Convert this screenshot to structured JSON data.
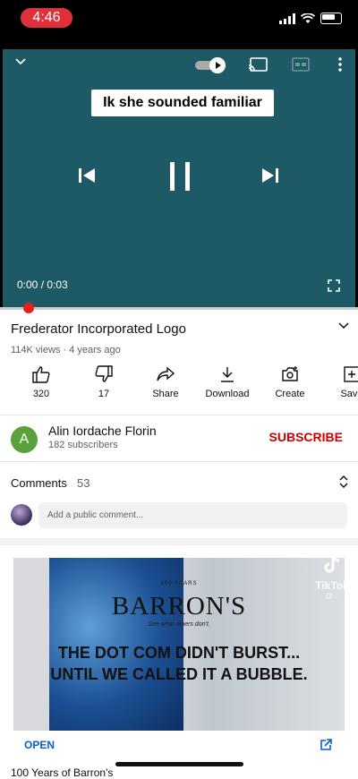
{
  "status": {
    "time": "4:46"
  },
  "player": {
    "caption": "Ik she sounded familiar",
    "time_readout": "0:00 / 0:03",
    "progress_fraction": 0.0
  },
  "video": {
    "title": "Frederator Incorporated Logo",
    "meta": "114K views · 4 years ago"
  },
  "actions": [
    {
      "label": "320",
      "icon": "thumbs-up-icon"
    },
    {
      "label": "17",
      "icon": "thumbs-down-icon"
    },
    {
      "label": "Share",
      "icon": "share-icon"
    },
    {
      "label": "Download",
      "icon": "download-icon"
    },
    {
      "label": "Create",
      "icon": "create-icon"
    },
    {
      "label": "Save",
      "icon": "save-icon"
    }
  ],
  "channel": {
    "initial": "A",
    "name": "Alin Iordache Florin",
    "subscribers": "182 subscribers",
    "subscribe_label": "SUBSCRIBE",
    "avatar_color": "#5aa03b"
  },
  "comments": {
    "label": "Comments",
    "count": "53",
    "placeholder": "Add a public comment..."
  },
  "ad": {
    "years": "100 YEARS",
    "brand": "BARRON'S",
    "tagline": "See what others don't.",
    "headline_1": "THE DOT COM DIDN'T BURST...",
    "headline_2": "UNTIL WE CALLED IT A BUBBLE.",
    "open_label": "OPEN"
  },
  "watermark": {
    "label": "TikTok",
    "handle": "@..."
  },
  "next": {
    "title": "100 Years of Barron's"
  },
  "colors": {
    "accent_red": "#e62117",
    "subscribe_red": "#cc0000",
    "link_blue": "#065fd4",
    "player_bg": "#1d5a66"
  }
}
